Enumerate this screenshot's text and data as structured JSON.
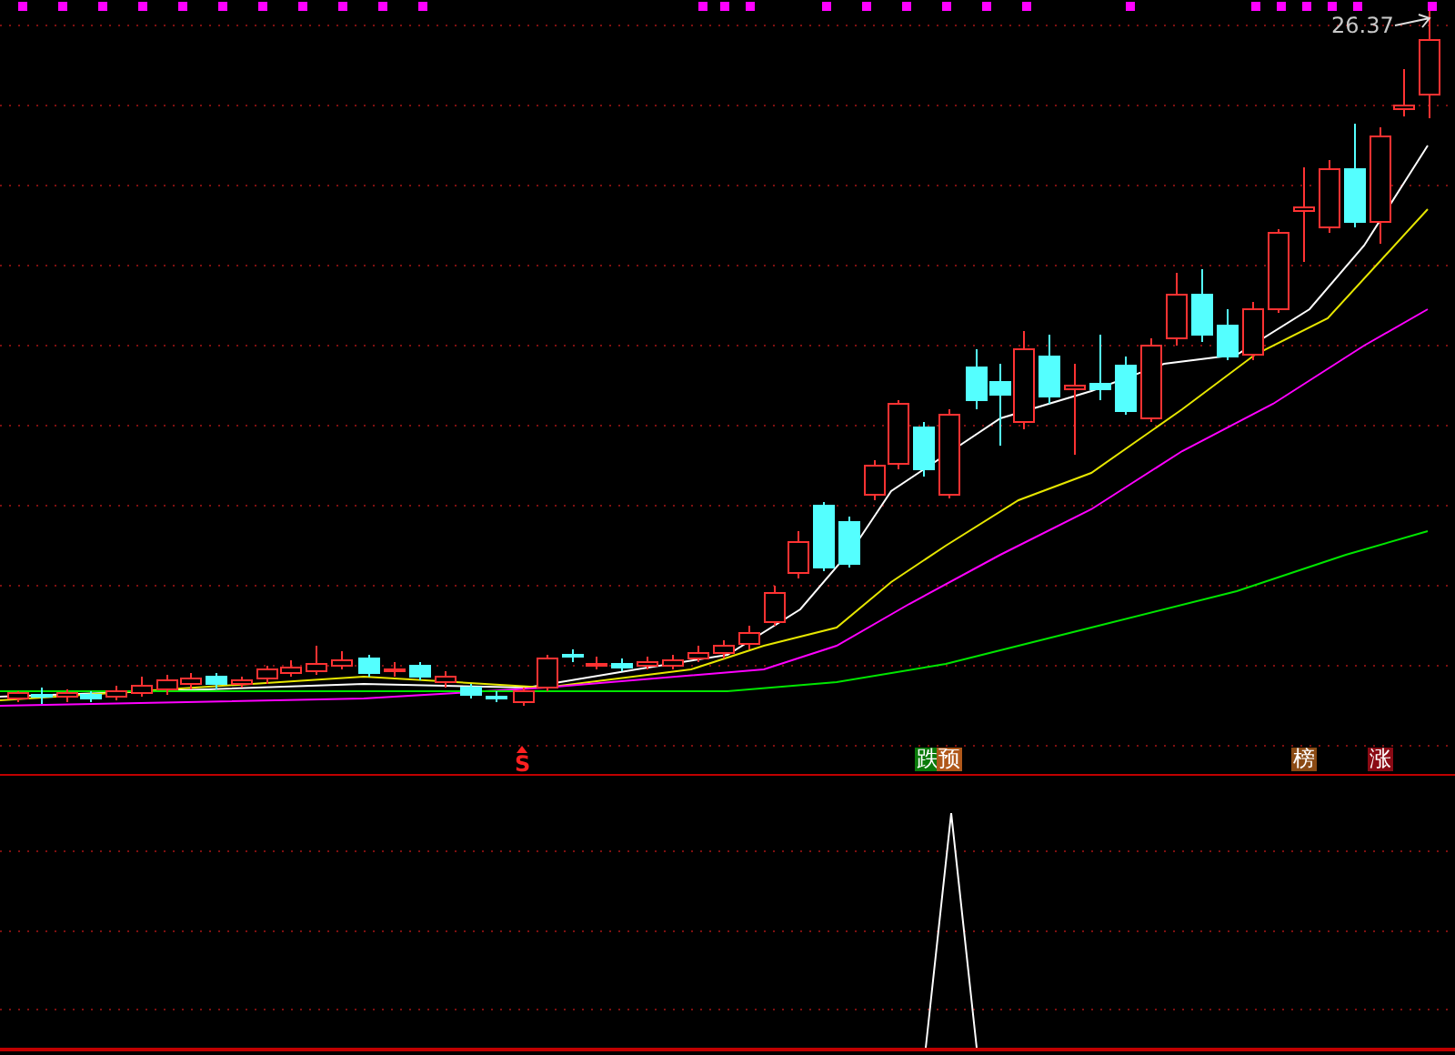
{
  "price_label": "26.37",
  "signals": [
    {
      "kind": "text",
      "label": "S",
      "color": "#ff2020"
    },
    {
      "kind": "badge",
      "label": "跌",
      "color": "#0a7a0a"
    },
    {
      "kind": "badge",
      "label": "预",
      "color": "#b0581a"
    },
    {
      "kind": "badge",
      "label": "榜",
      "color": "#8a4a14"
    },
    {
      "kind": "badge",
      "label": "涨",
      "color": "#8a0a14"
    }
  ]
}
